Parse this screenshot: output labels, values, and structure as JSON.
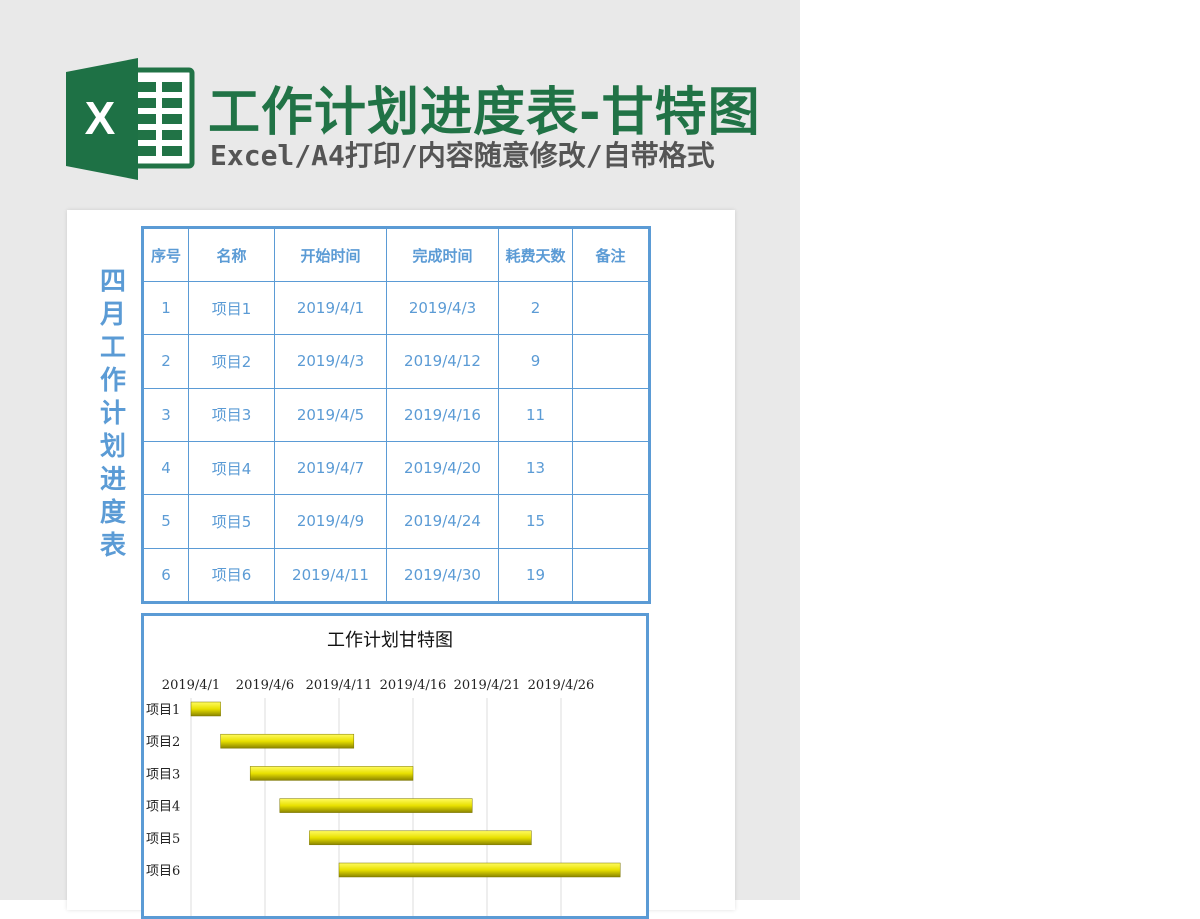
{
  "header": {
    "title": "工作计划进度表-甘特图",
    "subtitle": "Excel/A4打印/内容随意修改/自带格式",
    "logo_letter": "X",
    "brand_color": "#217346"
  },
  "sheet": {
    "side_title": [
      "四",
      "月",
      "工",
      "作",
      "计",
      "划",
      "进",
      "度",
      "表"
    ],
    "accent_color": "#5b9bd5",
    "columns": [
      "序号",
      "名称",
      "开始时间",
      "完成时间",
      "耗费天数",
      "备注"
    ],
    "rows": [
      [
        "1",
        "项目1",
        "2019/4/1",
        "2019/4/3",
        "2",
        ""
      ],
      [
        "2",
        "项目2",
        "2019/4/3",
        "2019/4/12",
        "9",
        ""
      ],
      [
        "3",
        "项目3",
        "2019/4/5",
        "2019/4/16",
        "11",
        ""
      ],
      [
        "4",
        "项目4",
        "2019/4/7",
        "2019/4/20",
        "13",
        ""
      ],
      [
        "5",
        "项目5",
        "2019/4/9",
        "2019/4/24",
        "15",
        ""
      ],
      [
        "6",
        "项目6",
        "2019/4/11",
        "2019/4/30",
        "19",
        ""
      ]
    ]
  },
  "chart_data": {
    "type": "bar",
    "orientation": "horizontal-gantt",
    "title": "工作计划甘特图",
    "categories": [
      "项目1",
      "项目2",
      "项目3",
      "项目4",
      "项目5",
      "项目6"
    ],
    "start": [
      "2019/4/1",
      "2019/4/3",
      "2019/4/5",
      "2019/4/7",
      "2019/4/9",
      "2019/4/11"
    ],
    "duration_days": [
      2,
      9,
      11,
      13,
      15,
      19
    ],
    "x_tick_labels": [
      "2019/4/1",
      "2019/4/6",
      "2019/4/11",
      "2019/4/16",
      "2019/4/21",
      "2019/4/26"
    ],
    "xlim": [
      "2019/4/1",
      "2019/5/1"
    ],
    "grid": true,
    "bar_color": "#e8e000"
  }
}
